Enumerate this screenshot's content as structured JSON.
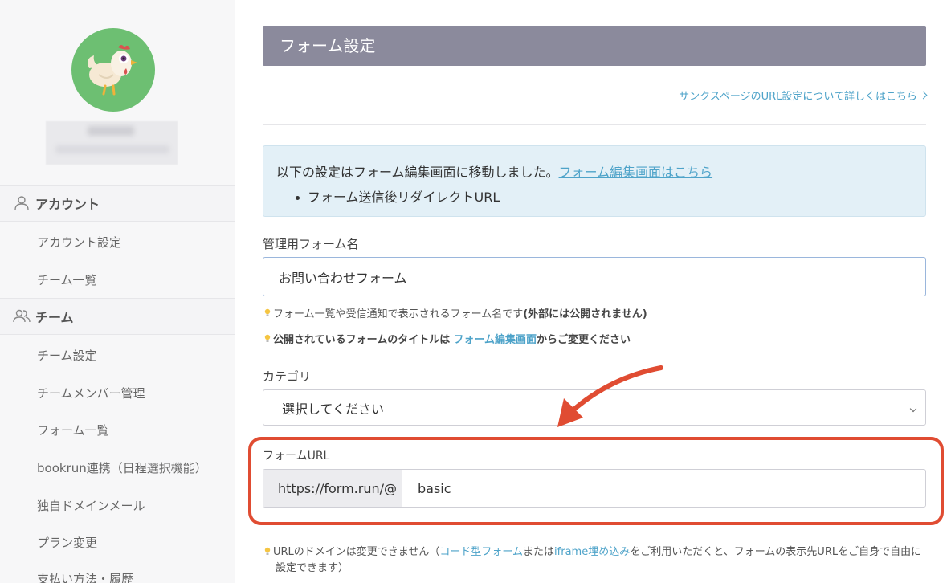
{
  "sidebar": {
    "account_section": {
      "label": "アカウント",
      "icon": "person-icon"
    },
    "account_items": [
      "アカウント設定",
      "チーム一覧"
    ],
    "team_section": {
      "label": "チーム",
      "icon": "people-icon"
    },
    "team_items": [
      "チーム設定",
      "チームメンバー管理",
      "フォーム一覧",
      "bookrun連携（日程選択機能）",
      "独自ドメインメール",
      "プラン変更",
      "支払い方法・履歴"
    ]
  },
  "main": {
    "title": "フォーム設定",
    "thanks_link": "サンクスページのURL設定について詳しくはこちら",
    "notice": {
      "text": "以下の設定はフォーム編集画面に移動しました。",
      "link": "フォーム編集画面はこちら",
      "bullet": "フォーム送信後リダイレクトURL"
    },
    "form_name": {
      "label": "管理用フォーム名",
      "value": "お問い合わせフォーム",
      "hint1_text": "フォーム一覧や受信通知で表示されるフォーム名です",
      "hint1_bold": "(外部には公開されません)",
      "hint2_bold_a": "公開されているフォームのタイトルは",
      "hint2_link": "フォーム編集画面",
      "hint2_bold_b": "からご変更ください"
    },
    "category": {
      "label": "カテゴリ",
      "selected": "選択してください"
    },
    "form_url": {
      "label": "フォームURL",
      "prefix": "https://form.run/@",
      "value": "basic",
      "hint_a": "URLのドメインは変更できません（",
      "hint_link1": "コード型フォーム",
      "hint_b": "または",
      "hint_link2": "iframe埋め込み",
      "hint_c": "をご利用いただくと、フォームの表示先URLをご自身で自由に",
      "hint_d": "設定できます）"
    }
  },
  "colors": {
    "header_bar": "#8b8a9c",
    "link": "#4ea3c9",
    "notice_bg": "#e3f0f7",
    "annotation": "#e04c32"
  }
}
